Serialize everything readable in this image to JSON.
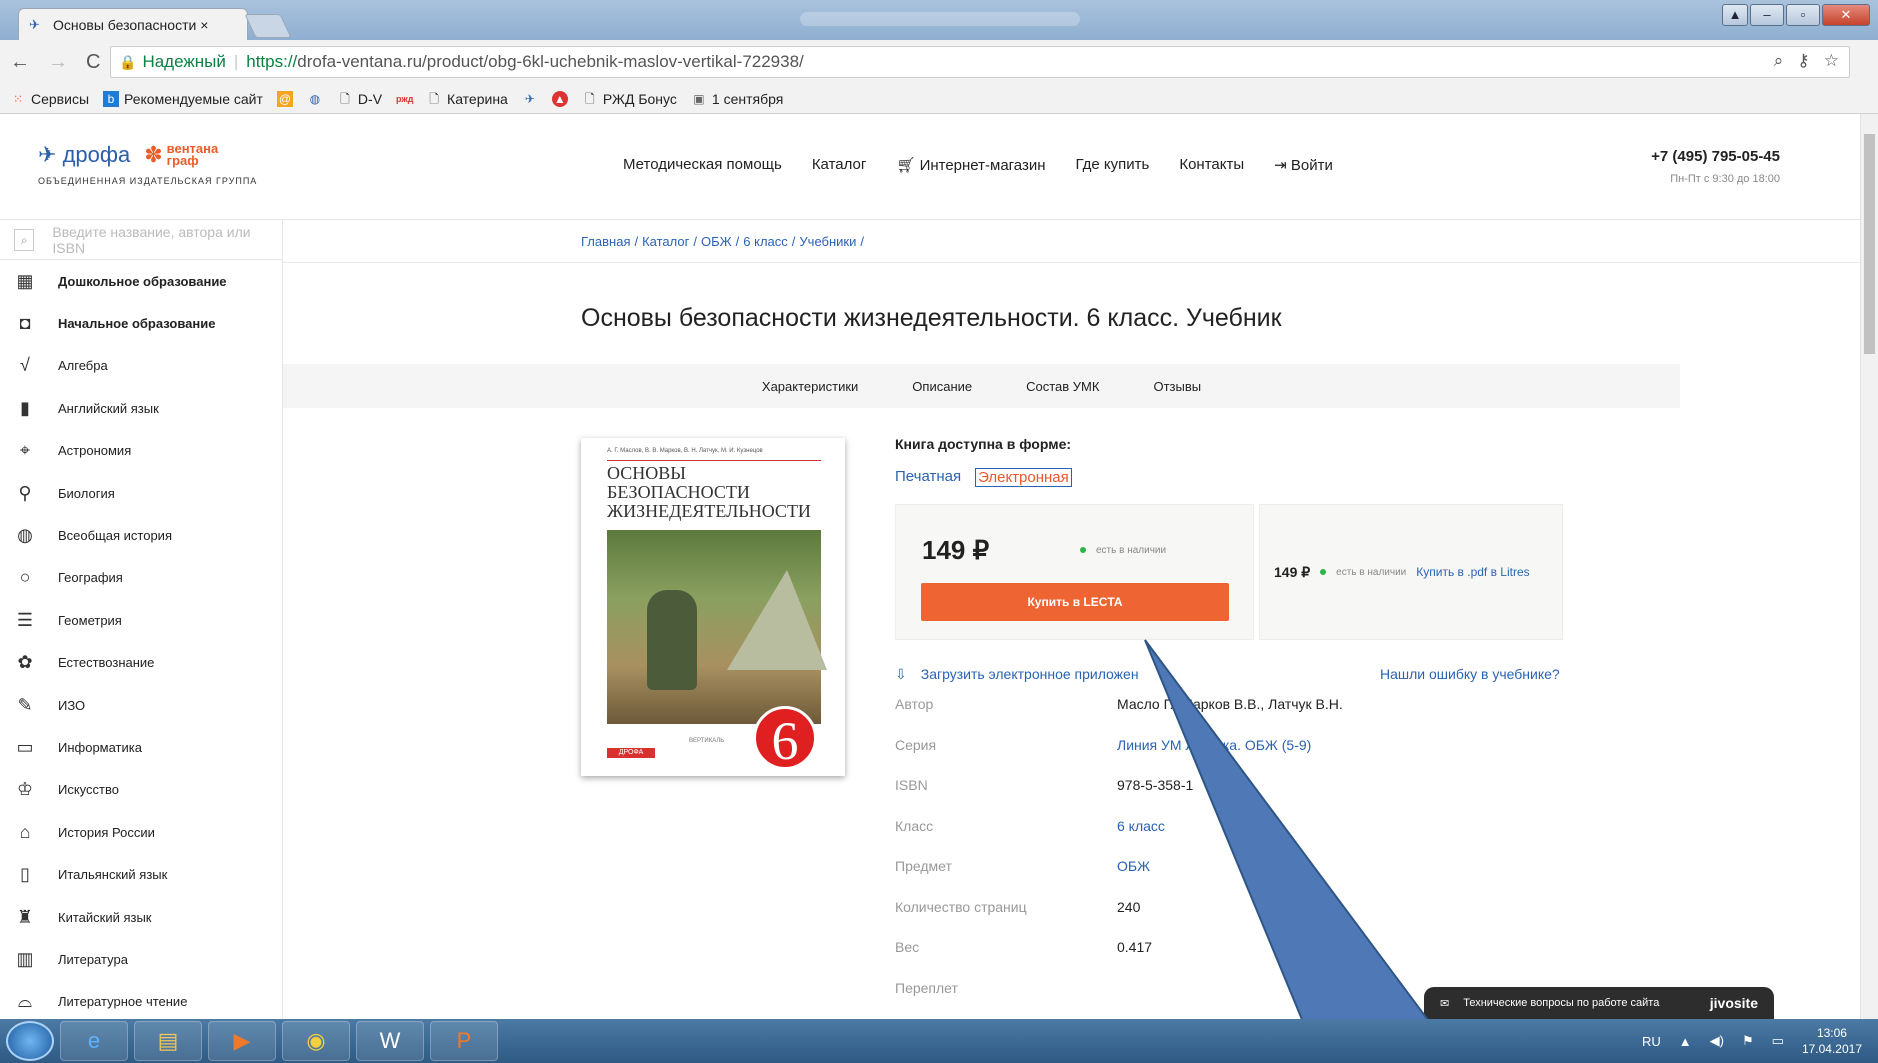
{
  "browser": {
    "tab_title": "Основы безопасности ×",
    "secure_label": "Надежный",
    "url_protocol": "https://",
    "url_rest": "drofa-ventana.ru/product/obg-6kl-uchebnik-maslov-vertikal-722938/",
    "bookmarks": [
      "Сервисы",
      "Рекомендуемые сайт",
      "D-V",
      "Катерина",
      "РЖД Бонус",
      "1 сентября"
    ]
  },
  "site": {
    "logo_main": "дрофа",
    "logo_second": "вентана граф",
    "logo_sub": "ОБЪЕДИНЕННАЯ ИЗДАТЕЛЬСКАЯ ГРУППА",
    "nav": [
      "Методическая помощь",
      "Каталог",
      "Интернет-магазин",
      "Где купить",
      "Контакты",
      "Войти"
    ],
    "phone": "+7 (495) 795-05-45",
    "hours": "Пн-Пт с 9:30 до 18:00"
  },
  "sidebar": {
    "search_placeholder": "Введите название, автора или ISBN",
    "items": [
      {
        "label": "Дошкольное образование",
        "icon": "blocks-icon"
      },
      {
        "label": "Начальное образование",
        "icon": "backpack-icon"
      },
      {
        "label": "Алгебра",
        "icon": "sqrt-icon"
      },
      {
        "label": "Английский язык",
        "icon": "big-ben-icon"
      },
      {
        "label": "Астрономия",
        "icon": "telescope-icon"
      },
      {
        "label": "Биология",
        "icon": "microscope-icon"
      },
      {
        "label": "Всеобщая история",
        "icon": "globe-icon"
      },
      {
        "label": "География",
        "icon": "pin-icon"
      },
      {
        "label": "Геометрия",
        "icon": "ruler-icon"
      },
      {
        "label": "Естествознание",
        "icon": "plant-icon"
      },
      {
        "label": "ИЗО",
        "icon": "palette-icon"
      },
      {
        "label": "Информатика",
        "icon": "monitor-icon"
      },
      {
        "label": "Искусство",
        "icon": "theater-icon"
      },
      {
        "label": "История России",
        "icon": "columns-icon"
      },
      {
        "label": "Итальянский язык",
        "icon": "tower-icon"
      },
      {
        "label": "Китайский язык",
        "icon": "pagoda-icon"
      },
      {
        "label": "Литература",
        "icon": "book-icon"
      },
      {
        "label": "Литературное чтение",
        "icon": "open-book-icon"
      }
    ]
  },
  "breadcrumb": [
    "Главная",
    "/",
    "Каталог",
    "/",
    "ОБЖ",
    "/",
    "6 класс",
    "/",
    "Учебники",
    "/"
  ],
  "product": {
    "title": "Основы безопасности жизнедеятельности. 6 класс. Учебник",
    "tabs": [
      "Характеристики",
      "Описание",
      "Состав УМК",
      "Отзывы"
    ],
    "cover_authors": "А. Г. Маслов, В. В. Марков, В. Н. Латчук, М. И. Кузнецов",
    "cover_title": "ОСНОВЫ БЕЗОПАСНОСТИ ЖИЗНЕДЕЯТЕЛЬНОСТИ",
    "cover_number": "6",
    "cover_publisher": "ДРОФА",
    "cover_publisher2": "ВЕРТИКАЛЬ",
    "available_label": "Книга доступна в форме:",
    "form_print": "Печатная",
    "form_electronic": "Электронная",
    "price": "149 ₽",
    "stock": "есть в наличии",
    "buy_button": "Купить в LECTA",
    "price2": "149 ₽",
    "stock2": "есть в наличии",
    "litres_link": "Купить в .pdf в Litres",
    "download_link": "Загрузить электронное приложен",
    "error_link": "Нашли ошибку в учебнике?",
    "props": [
      {
        "k": "Автор",
        "v": "Масло  Г., Марков В.В., Латчук В.Н.",
        "link": false
      },
      {
        "k": "Серия",
        "v": "Линия УМ     Латчука. ОБЖ (5-9)",
        "link": true
      },
      {
        "k": "ISBN",
        "v": "978-5-358-1",
        "link": false
      },
      {
        "k": "Класс",
        "v": "6 класс",
        "link": true
      },
      {
        "k": "Предмет",
        "v": "ОБЖ",
        "link": true
      },
      {
        "k": "Количество страниц",
        "v": "240",
        "link": false
      },
      {
        "k": "Вес",
        "v": "0.417",
        "link": false
      },
      {
        "k": "Переплет",
        "v": "",
        "link": false
      }
    ]
  },
  "chat": {
    "text": "Технические вопросы по работе сайта",
    "brand": "jivosite"
  },
  "taskbar": {
    "lang": "RU",
    "time": "13:06",
    "date": "17.04.2017"
  }
}
